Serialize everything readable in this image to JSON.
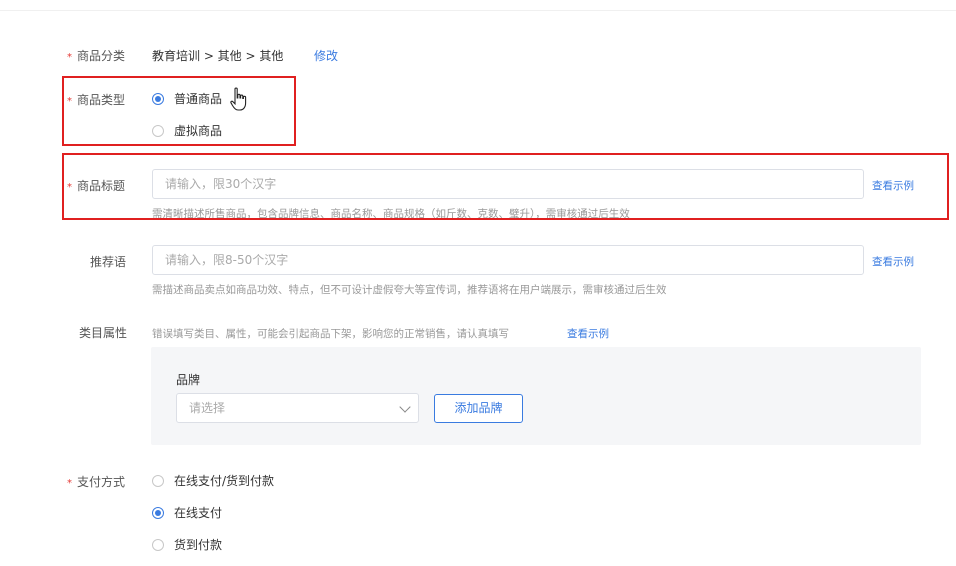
{
  "category": {
    "label": "商品分类",
    "value": "教育培训 > 其他 > 其他",
    "edit_link": "修改"
  },
  "product_type": {
    "label": "商品类型",
    "options": [
      "普通商品",
      "虚拟商品"
    ],
    "selected": "普通商品"
  },
  "title": {
    "label": "商品标题",
    "placeholder": "请输入，限30个汉字",
    "example_link": "查看示例",
    "hint": "需清晰描述所售商品，包含品牌信息、商品名称、商品规格（如斤数、克数、璧升），需审核通过后生效"
  },
  "slogan": {
    "label": "推荐语",
    "placeholder": "请输入，限8-50个汉字",
    "example_link": "查看示例",
    "hint": "需描述商品卖点如商品功效、特点，但不可设计虚假夸大等宣传词，推荐语将在用户端展示，需审核通过后生效"
  },
  "attributes": {
    "label": "类目属性",
    "hint": "错误填写类目、属性，可能会引起商品下架，影响您的正常销售，请认真填写",
    "example_link": "查看示例",
    "brand_label": "品牌",
    "brand_placeholder": "请选择",
    "add_brand_button": "添加品牌"
  },
  "payment": {
    "label": "支付方式",
    "options": [
      "在线支付/货到付款",
      "在线支付",
      "货到付款"
    ],
    "selected": "在线支付"
  },
  "colors": {
    "accent": "#3a7be0",
    "required": "#e53935",
    "highlight_box": "#e02020"
  }
}
